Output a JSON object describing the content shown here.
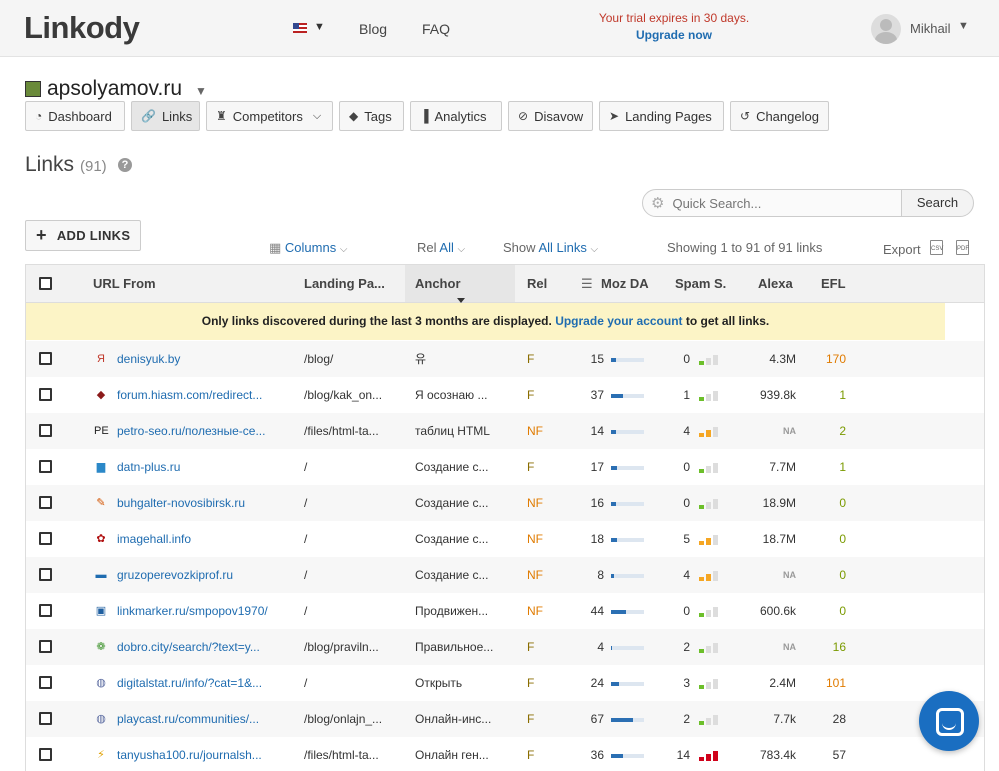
{
  "app": {
    "logo": "Linkody"
  },
  "header": {
    "nav": {
      "blog": "Blog",
      "faq": "FAQ"
    },
    "trial": "Your trial expires in 30 days.",
    "upgrade": "Upgrade now",
    "user": "Mikhail"
  },
  "site": {
    "name": "apsolyamov.ru"
  },
  "tabs": [
    {
      "label": "Dashboard",
      "icon": "dashboard-icon"
    },
    {
      "label": "Links",
      "icon": "link-icon"
    },
    {
      "label": "Competitors",
      "icon": "chess-icon"
    },
    {
      "label": "Tags",
      "icon": "tag-icon"
    },
    {
      "label": "Analytics",
      "icon": "bar-chart-icon"
    },
    {
      "label": "Disavow",
      "icon": "ban-icon"
    },
    {
      "label": "Landing Pages",
      "icon": "send-icon"
    },
    {
      "label": "Changelog",
      "icon": "history-icon"
    }
  ],
  "page": {
    "title": "Links",
    "count": "(91)"
  },
  "search": {
    "placeholder": "Quick Search...",
    "button": "Search"
  },
  "toolbar": {
    "add_links": "ADD LINKS",
    "columns": "Columns",
    "rel_label": "Rel",
    "rel_value": "All",
    "show_label": "Show",
    "show_value": "All Links",
    "showing": "Showing 1 to 91 of 91 links",
    "export": "Export"
  },
  "table": {
    "headers": {
      "url_from": "URL From",
      "landing": "Landing Pa...",
      "anchor": "Anchor",
      "rel": "Rel",
      "moz": "Moz DA",
      "spam": "Spam S.",
      "alexa": "Alexa",
      "efl": "EFL"
    },
    "notice_pre": "Only links discovered during the last 3 months are displayed.",
    "notice_link": "Upgrade your account",
    "notice_post": "to get all links.",
    "rows": [
      {
        "url": "denisyuk.by",
        "landing": "/blog/",
        "anchor": "유",
        "rel": "F",
        "moz": "15",
        "moz_pct": 15,
        "spam": "0",
        "spam_level": 0,
        "alexa": "4.3M",
        "efl": "170",
        "efl_color": "#e07b00",
        "fav": "Я",
        "fav_color": "#c0392b"
      },
      {
        "url": "forum.hiasm.com/redirect...",
        "landing": "/blog/kak_on...",
        "anchor": "Я осознаю ...",
        "rel": "F",
        "moz": "37",
        "moz_pct": 37,
        "spam": "1",
        "spam_level": 1,
        "alexa": "939.8k",
        "efl": "1",
        "efl_color": "#7a9a00",
        "fav": "◆",
        "fav_color": "#8b1a1a"
      },
      {
        "url": "petro-seo.ru/полезные-се...",
        "landing": "/files/html-ta...",
        "anchor": "таблиц HTML",
        "rel": "NF",
        "moz": "14",
        "moz_pct": 14,
        "spam": "4",
        "spam_level": 2,
        "alexa": "NA",
        "efl": "2",
        "efl_color": "#7a9a00",
        "fav": "PE",
        "fav_color": "#222"
      },
      {
        "url": "datn-plus.ru",
        "landing": "/",
        "anchor": "Создание с...",
        "rel": "F",
        "moz": "17",
        "moz_pct": 17,
        "spam": "0",
        "spam_level": 0,
        "alexa": "7.7M",
        "efl": "1",
        "efl_color": "#7a9a00",
        "fav": "▆",
        "fav_color": "#2b88c8"
      },
      {
        "url": "buhgalter-novosibirsk.ru",
        "landing": "/",
        "anchor": "Создание с...",
        "rel": "NF",
        "moz": "16",
        "moz_pct": 16,
        "spam": "0",
        "spam_level": 0,
        "alexa": "18.9M",
        "efl": "0",
        "efl_color": "#7a9a00",
        "fav": "✎",
        "fav_color": "#d35400"
      },
      {
        "url": "imagehall.info",
        "landing": "/",
        "anchor": "Создание с...",
        "rel": "NF",
        "moz": "18",
        "moz_pct": 18,
        "spam": "5",
        "spam_level": 2,
        "alexa": "18.7M",
        "efl": "0",
        "efl_color": "#7a9a00",
        "fav": "✿",
        "fav_color": "#b01010"
      },
      {
        "url": "gruzoperevozkiprof.ru",
        "landing": "/",
        "anchor": "Создание с...",
        "rel": "NF",
        "moz": "8",
        "moz_pct": 8,
        "spam": "4",
        "spam_level": 2,
        "alexa": "NA",
        "efl": "0",
        "efl_color": "#7a9a00",
        "fav": "▬",
        "fav_color": "#1f6cb0"
      },
      {
        "url": "linkmarker.ru/smpopov1970/",
        "landing": "/",
        "anchor": "Продвижен...",
        "rel": "NF",
        "moz": "44",
        "moz_pct": 44,
        "spam": "0",
        "spam_level": 0,
        "alexa": "600.6k",
        "efl": "0",
        "efl_color": "#7a9a00",
        "fav": "▣",
        "fav_color": "#1f5fa0"
      },
      {
        "url": "dobro.city/search/?text=y...",
        "landing": "/blog/praviln...",
        "anchor": "Правильное...",
        "rel": "F",
        "moz": "4",
        "moz_pct": 4,
        "spam": "2",
        "spam_level": 1,
        "alexa": "NA",
        "efl": "16",
        "efl_color": "#7a9a00",
        "fav": "❁",
        "fav_color": "#4a9a3a"
      },
      {
        "url": "digitalstat.ru/info/?cat=1&...",
        "landing": "/",
        "anchor": "Открыть",
        "rel": "F",
        "moz": "24",
        "moz_pct": 24,
        "spam": "3",
        "spam_level": 1,
        "alexa": "2.4M",
        "efl": "101",
        "efl_color": "#e07b00",
        "fav": "◍",
        "fav_color": "#5a6aa0"
      },
      {
        "url": "playcast.ru/communities/...",
        "landing": "/blog/onlajn_...",
        "anchor": "Онлайн-инс...",
        "rel": "F",
        "moz": "67",
        "moz_pct": 67,
        "spam": "2",
        "spam_level": 1,
        "alexa": "7.7k",
        "efl": "28",
        "efl_color": "#333",
        "fav": "◍",
        "fav_color": "#5a6aa0"
      },
      {
        "url": "tanyusha100.ru/journalsh...",
        "landing": "/files/html-ta...",
        "anchor": "Онлайн ген...",
        "rel": "F",
        "moz": "36",
        "moz_pct": 36,
        "spam": "14",
        "spam_level": 3,
        "alexa": "783.4k",
        "efl": "57",
        "efl_color": "#333",
        "fav": "⚡",
        "fav_color": "#e0a000"
      }
    ]
  }
}
